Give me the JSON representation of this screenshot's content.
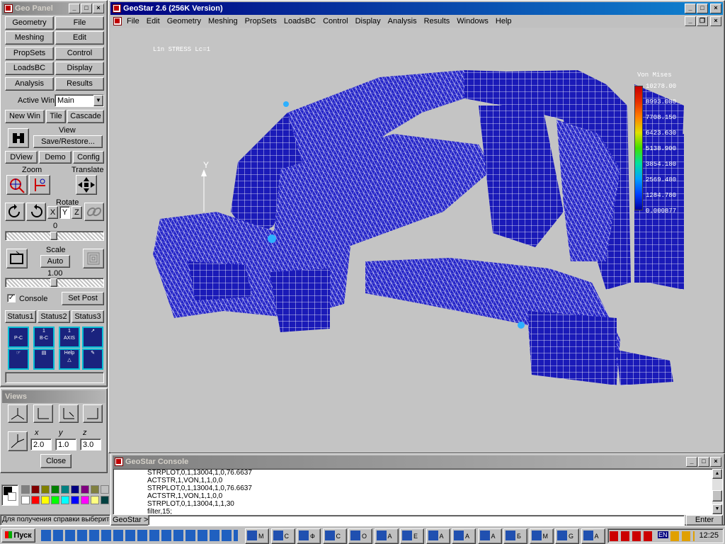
{
  "geo_panel": {
    "title": "Geo Panel",
    "menu_buttons": [
      "Geometry",
      "File",
      "Meshing",
      "Edit",
      "PropSets",
      "Control",
      "LoadsBC",
      "Display",
      "Analysis",
      "Results"
    ],
    "active_win_label": "Active Win",
    "active_win_value": "Main",
    "new_win": "New Win",
    "tile": "Tile",
    "cascade": "Cascade",
    "view_label": "View",
    "save_restore": "Save/Restore...",
    "dview": "DView",
    "demo": "Demo",
    "config": "Config",
    "zoom_label": "Zoom",
    "translate_label": "Translate",
    "rotate_label": "Rotate",
    "rotate_axes": [
      "X",
      "Y",
      "Z"
    ],
    "rotate_value": "0",
    "scale_label": "Scale",
    "auto": "Auto",
    "scale_value": "1.00",
    "console_label": "Console",
    "console_checked": true,
    "set_post": "Set Post",
    "status_tabs": [
      "Status1",
      "Status2",
      "Status3"
    ],
    "tool_icons": [
      [
        "P-C",
        ""
      ],
      [
        "1",
        "B-C"
      ],
      [
        "1",
        "AXIS"
      ],
      [
        "",
        ""
      ],
      [
        "",
        ""
      ],
      [
        "",
        ""
      ],
      [
        "Help",
        ""
      ],
      [
        "",
        ""
      ]
    ]
  },
  "views": {
    "title": "Views",
    "x_label": "x",
    "y_label": "y",
    "z_label": "z",
    "x_value": "2.0",
    "y_value": "1.0",
    "z_value": "3.0",
    "close": "Close"
  },
  "palette_colors": [
    "#ffffff",
    "#000000",
    "#808080",
    "#800000",
    "#808000",
    "#008000",
    "#008080",
    "#000080",
    "#800080",
    "#808040",
    "#c0c0c0",
    "#ffffff",
    "#ff0000",
    "#ffff00",
    "#00ff00",
    "#00ffff",
    "#0000ff",
    "#ff00ff",
    "#ffff80",
    "#004040"
  ],
  "status_bar_text": "Для получения справки выберите",
  "main_window": {
    "title": "GeoStar 2.6 (256K Version)",
    "menu": [
      "File",
      "Edit",
      "Geometry",
      "Meshing",
      "PropSets",
      "LoadsBC",
      "Control",
      "Display",
      "Analysis",
      "Results",
      "Windows",
      "Help"
    ],
    "plot_caption": "L1n STRESS Lc=1",
    "axis_label": "Y"
  },
  "chart_data": {
    "type": "heatmap",
    "title": "Von Mises",
    "legend_values": [
      "10278.00",
      "8993.080",
      "7708.150",
      "6423.630",
      "5138.900",
      "3854.180",
      "2569.480",
      "1284.780",
      "0.000877"
    ],
    "legend_colors": [
      "#c80000",
      "#e83000",
      "#ff8000",
      "#e0e000",
      "#40e000",
      "#00e0a0",
      "#00a0ff",
      "#0040ff",
      "#0000a0"
    ]
  },
  "console": {
    "title": "GeoStar Console",
    "lines": [
      "STRPLOT,0,1,13004,1,0,76.6637",
      "ACTSTR,1,VON,1,1,0,0",
      "STRPLOT,0,1,13004,1,0,76.6637",
      "ACTSTR,1,VON,1,1,0,0",
      "STRPLOT,0,1,13004,1,1,30",
      "filter,15;"
    ],
    "prompt": "GeoStar >",
    "enter": "Enter"
  },
  "taskbar": {
    "start": "Пуск",
    "tasks": [
      "М",
      "С",
      "Ф",
      "С",
      "О",
      "А",
      "Е",
      "А",
      "А",
      "А",
      "Б",
      "М",
      "G",
      "А"
    ],
    "tray_lang": "EN",
    "clock": "12:25"
  }
}
